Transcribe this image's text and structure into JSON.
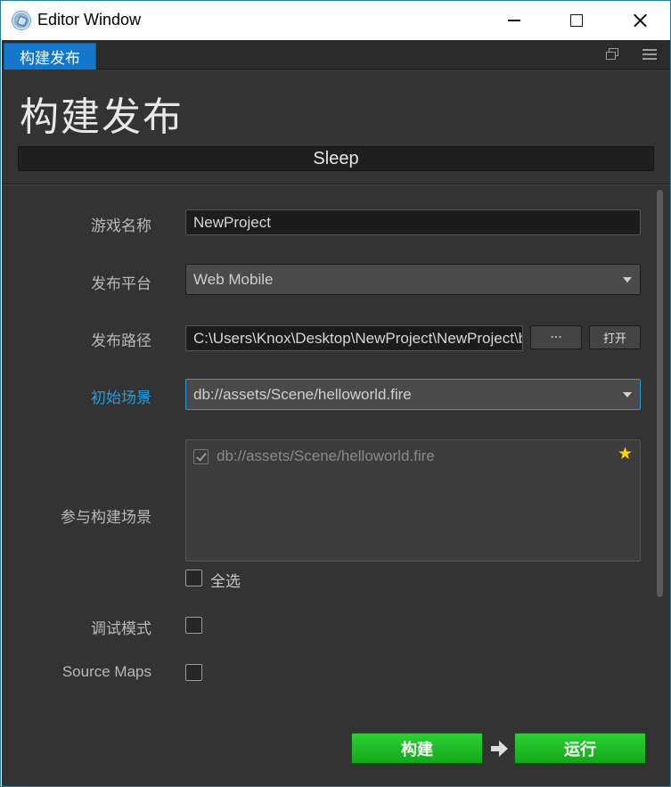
{
  "window": {
    "title": "Editor Window"
  },
  "panel": {
    "tab_label": "构建发布",
    "heading": "构建发布",
    "status": "Sleep"
  },
  "form": {
    "game_name": {
      "label": "游戏名称",
      "value": "NewProject"
    },
    "platform": {
      "label": "发布平台",
      "value": "Web Mobile"
    },
    "build_path": {
      "label": "发布路径",
      "value": "C:\\Users\\Knox\\Desktop\\NewProject\\NewProject\\build",
      "browse_label": "···",
      "open_label": "打开"
    },
    "start_scene": {
      "label": "初始场景",
      "value": "db://assets/Scene/helloworld.fire"
    },
    "included_scenes": {
      "label": "参与构建场景",
      "items": [
        {
          "path": "db://assets/Scene/helloworld.fire",
          "checked": true,
          "is_start": true
        }
      ],
      "select_all_label": "全选",
      "select_all_checked": false
    },
    "debug_mode": {
      "label": "调试模式",
      "checked": false
    },
    "source_maps": {
      "label": "Source Maps",
      "checked": false
    }
  },
  "actions": {
    "build_label": "构建",
    "run_label": "运行"
  },
  "colors": {
    "accent": "#1577c9",
    "active_label": "#2a9ad6",
    "action_green": "#1fbf26",
    "panel_bg": "#333333",
    "star": "#ffd400"
  },
  "icons": [
    "app-icon",
    "minimize-icon",
    "maximize-icon",
    "close-icon",
    "popout-icon",
    "menu-icon",
    "dropdown-caret-icon",
    "star-icon",
    "check-icon",
    "arrow-right-icon"
  ]
}
